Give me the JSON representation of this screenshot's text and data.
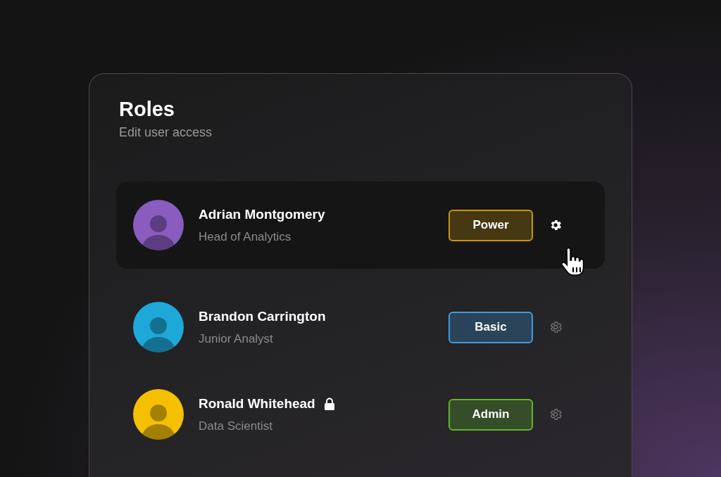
{
  "header": {
    "title": "Roles",
    "subtitle": "Edit user access"
  },
  "users": [
    {
      "name": "Adrian Montgomery",
      "job": "Head of Analytics",
      "avatar": {
        "color": "#8a5cc0"
      },
      "role": "Power",
      "color": "#c9960c",
      "selected": true,
      "locked": false
    },
    {
      "name": "Brandon Carrington",
      "job": "Junior Analyst",
      "avatar": {
        "color": "#1ea8d8"
      },
      "role": "Basic",
      "color": "#3b9be0",
      "selected": false,
      "locked": false
    },
    {
      "name": "Ronald Whitehead",
      "job": "Data Scientist",
      "avatar": {
        "color": "#f5c000"
      },
      "role": "Admin",
      "color": "#5cb82a",
      "selected": false,
      "locked": true
    }
  ]
}
